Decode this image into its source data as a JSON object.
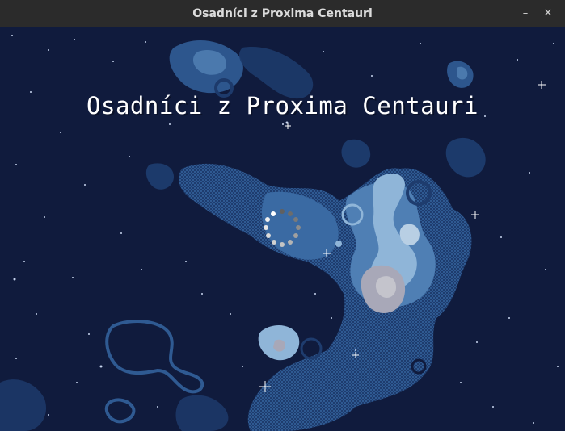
{
  "window": {
    "title": "Osadníci z Proxima Centauri",
    "minimize_glyph": "–",
    "close_glyph": "✕"
  },
  "game": {
    "title": "Osadníci z Proxima Centauri",
    "state": "loading",
    "loading_indicator": "spinner-dots"
  },
  "colors": {
    "space": "#101b3d",
    "nebula_dark": "#1e3c6e",
    "nebula_mid": "#2f5a92",
    "nebula_light": "#4f7fb4",
    "nebula_pale": "#8fb5d8",
    "nebula_grey": "#a8a8b8",
    "titlebar": "#2b2b2b"
  }
}
